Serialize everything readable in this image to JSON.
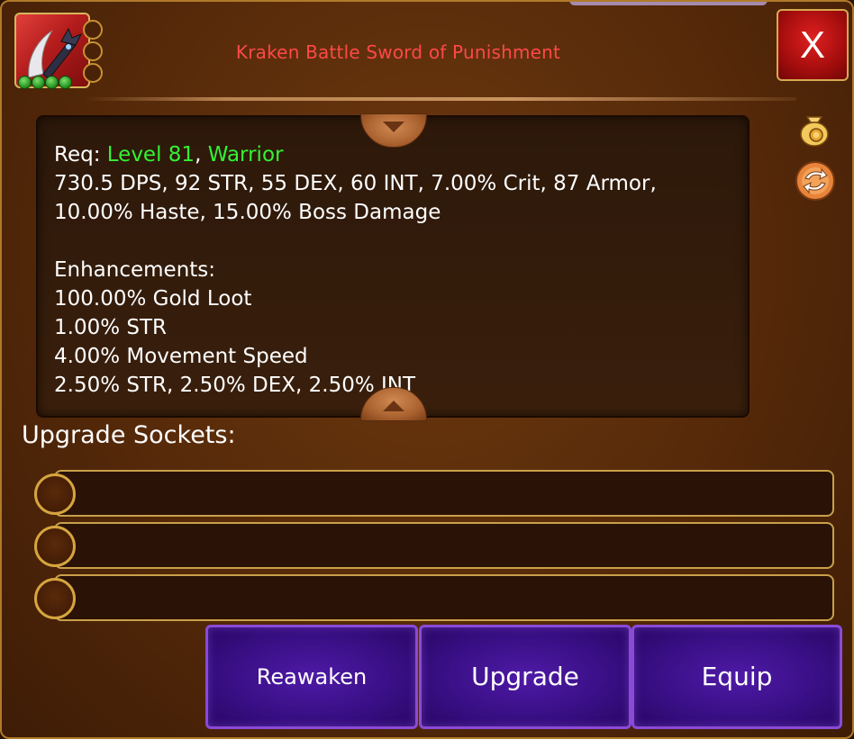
{
  "item": {
    "name": "Kraken Battle Sword of Punishment",
    "icon": "sword-icon",
    "gem_count": 4,
    "empty_slot_count": 3
  },
  "close_label": "X",
  "description": {
    "req_prefix": "Req: ",
    "req_level": "Level 81",
    "req_sep": ", ",
    "req_class": "Warrior",
    "stats_line1": "730.5 DPS, 92 STR, 55 DEX, 60 INT, 7.00% Crit, 87 Armor,",
    "stats_line2": "10.00% Haste, 15.00% Boss Damage",
    "enhancements_header": "Enhancements:",
    "enhancements": [
      "100.00% Gold Loot",
      "1.00% STR",
      "4.00% Movement Speed",
      "2.50% STR, 2.50% DEX, 2.50% INT"
    ]
  },
  "side_icons": [
    "gold-bag-icon",
    "swap-icon"
  ],
  "sockets": {
    "label": "Upgrade Sockets:",
    "slots": [
      "",
      "",
      ""
    ]
  },
  "actions": {
    "reawaken": "Reawaken",
    "upgrade": "Upgrade",
    "equip": "Equip"
  },
  "colors": {
    "title": "#ff4848",
    "requirement": "#33f233",
    "button": "#3a0f86",
    "close": "#c01010"
  }
}
